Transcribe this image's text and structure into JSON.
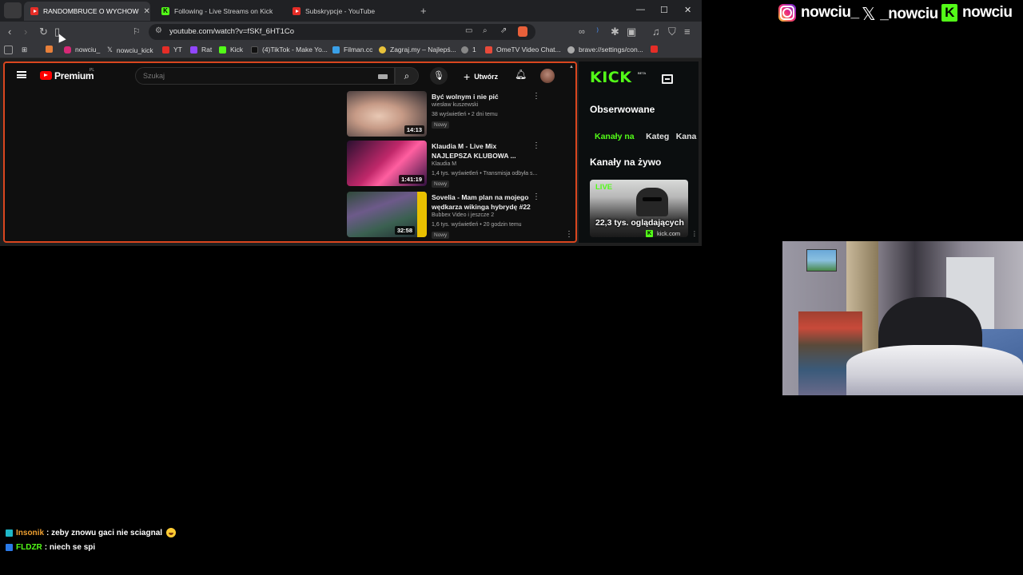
{
  "browser": {
    "tabs": [
      {
        "label": "RANDOMBRUCE O WYCHOW",
        "icon": "youtube-icon",
        "active": true
      },
      {
        "label": "Following - Live Streams on Kick",
        "icon": "kick-icon",
        "active": false
      },
      {
        "label": "Subskrypcje - YouTube",
        "icon": "youtube-icon",
        "active": false
      }
    ],
    "url": "youtube.com/watch?v=fSKf_6HT1Co",
    "bookmarks": [
      "nowciu_",
      "nowciu_kick",
      "YT",
      "Rat",
      "Kick",
      "(4)TikTok - Make Yo...",
      "Filman.cc",
      "Zagraj.my – Najlepś...",
      "1",
      "OmeTV Video Chat...",
      "brave://settings/con..."
    ]
  },
  "youtube": {
    "logo_text": "Premium",
    "country": "PL",
    "search_placeholder": "Szukaj",
    "create_label": "Utwórz",
    "videos": [
      {
        "title": "Być wolnym i nie pić",
        "channel": "wiesław kuszewski",
        "meta": "38 wyświetleń • 2 dni temu",
        "badge": "Nowy",
        "duration": "14:13"
      },
      {
        "title": "Klaudia M - Live Mix NAJLEPSZA KLUBOWA ...",
        "channel": "Klaudia M",
        "meta": "1,4 tys. wyświetleń • Transmisja odbyła s...",
        "badge": "Nowy",
        "duration": "1:41:19"
      },
      {
        "title": "Sovelia - Mam plan na mojego wędkarza wikinga hybrydę #22",
        "channel": "Bubbex Video i jeszcze 2",
        "meta": "1,6 tys. wyświetleń • 20 godzin temu",
        "badge": "Nowy",
        "duration": "32:58"
      }
    ]
  },
  "kick": {
    "logo": "KICK",
    "beta": "BETA",
    "heading": "Obserwowane",
    "tabs": [
      "Kanały na",
      "Kateg",
      "Kana"
    ],
    "live_heading": "Kanały na żywo",
    "live_label": "LIVE",
    "viewers": "22,3 tys. oglądających",
    "domain": "kick.com"
  },
  "socials": {
    "instagram": "nowciu_",
    "x": "_nowciu",
    "kick": "nowciu"
  },
  "chat": [
    {
      "user": "Insonik",
      "message": ": zeby znowu gaci nie sciagnal"
    },
    {
      "user": "FLDZR",
      "message": ": niech se spi"
    }
  ],
  "colors": {
    "kick_green": "#53fc18",
    "yt_red": "#ff0000",
    "pane_border": "#d9461f"
  }
}
